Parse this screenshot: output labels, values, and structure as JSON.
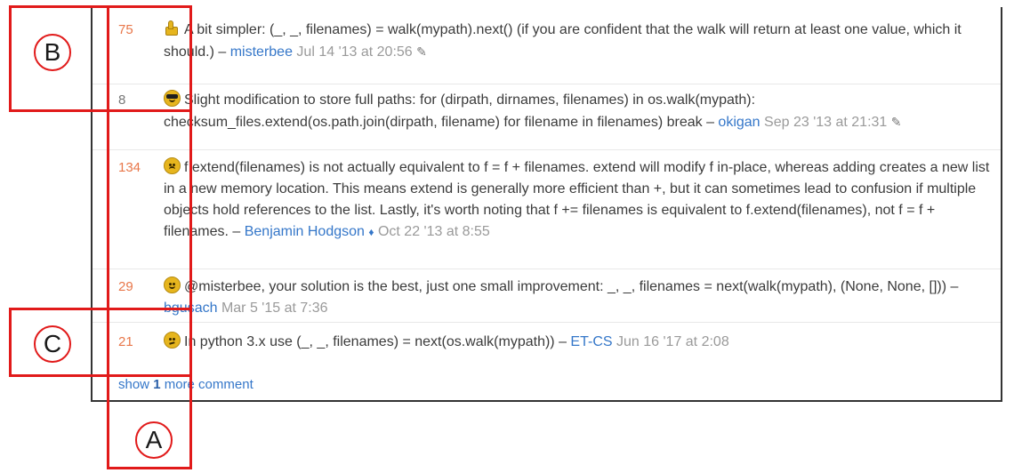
{
  "comments": [
    {
      "score": "75",
      "score_color": "#e8774a",
      "emoji": "thumbs-up-icon",
      "text": "A bit simpler: (_, _, filenames) = walk(mypath).next() (if you are confident that the walk will return at least one value, which it should.) –",
      "user": "misterbee",
      "date": "Jul 14 '13 at 20:56",
      "edited": true
    },
    {
      "score": "8",
      "score_color": "#777777",
      "emoji": "sunglasses-face-icon",
      "text": "Slight modification to store full paths: for (dirpath, dirnames, filenames) in os.walk(mypath): checksum_files.extend(os.path.join(dirpath, filename) for filename in filenames) break –",
      "user": "okigan",
      "date": "Sep 23 '13 at 21:31",
      "edited": true
    },
    {
      "score": "134",
      "score_color": "#e8774a",
      "emoji": "frowning-face-icon",
      "text": "f.extend(filenames) is not actually equivalent to f = f + filenames. extend will modify f in-place, whereas adding creates a new list in a new memory location. This means extend is generally more efficient than +, but it can sometimes lead to confusion if multiple objects hold references to the list. Lastly, it's worth noting that f += filenames is equivalent to f.extend(filenames), not f = f + filenames. –",
      "user": "Benjamin Hodgson",
      "moderator": "♦",
      "date": "Oct 22 '13 at 8:55",
      "edited": false
    },
    {
      "score": "29",
      "score_color": "#e8774a",
      "emoji": "smiling-face-icon",
      "text": "@misterbee, your solution is the best, just one small improvement: _, _, filenames = next(walk(mypath), (None, None, [])) –",
      "user": "bgusach",
      "date": "Mar 5 '15 at 7:36",
      "edited": false
    },
    {
      "score": "21",
      "score_color": "#e8774a",
      "emoji": "confused-face-icon",
      "text": "In python 3.x use (_, _, filenames) = next(os.walk(mypath)) –",
      "user": "ET-CS",
      "date": "Jun 16 '17 at 2:08",
      "edited": false
    }
  ],
  "show_more": {
    "prefix": "show",
    "count": "1",
    "suffix": "more comment"
  },
  "annotations": {
    "a": "A",
    "b": "B",
    "c": "C",
    "color": "#e11a1a"
  }
}
